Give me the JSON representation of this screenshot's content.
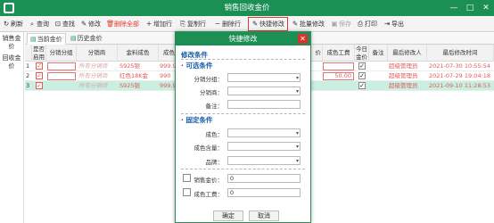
{
  "window": {
    "title": "销售回收金价"
  },
  "toolbar": {
    "refresh": "刷新",
    "query": "查询",
    "find": "查找",
    "edit": "修改",
    "delete_all": "删除全部",
    "add_row": "增加行",
    "copy_row": "复制行",
    "delete_row": "删除行",
    "quick_edit": "快捷修改",
    "batch_edit": "批量修改",
    "save": "保存",
    "print": "打印",
    "export": "导出"
  },
  "left_nav": [
    {
      "label": "销售金价"
    },
    {
      "label": "回收金价"
    }
  ],
  "tabs": [
    {
      "label": "当前金价"
    },
    {
      "label": "历史金价"
    }
  ],
  "grid": {
    "headers": {
      "num": "",
      "enabled": "是否启用",
      "group": "分销分组",
      "dealer": "分销商",
      "gold_color": "金料成色",
      "fineness": "成色",
      "price": "价",
      "labor": "成色工费",
      "today": "今日金价",
      "remark": "备注",
      "modifier": "最后修改人",
      "mod_time": "最后修改时间"
    },
    "rows": [
      {
        "num": "1",
        "dealer": "所有分销商",
        "gold_color": "S925银",
        "fineness": "999.9",
        "labor": "",
        "modifier": "超级管理员",
        "time": "2021-07-30 10:55:54"
      },
      {
        "num": "2",
        "dealer": "所有分销商",
        "gold_color": "红色18K金",
        "fineness": "990",
        "labor": "50.00",
        "modifier": "超级管理员",
        "time": "2021-07-29 19:04:18"
      },
      {
        "num": "3",
        "dealer": "所有分销商",
        "gold_color": "S925银",
        "fineness": "999.9",
        "labor": "",
        "modifier": "超级管理员",
        "time": "2021-09-10 11:28:53"
      }
    ]
  },
  "dialog": {
    "title": "快捷修改",
    "section_conditions": "修改条件",
    "section_optional": "· 可选条件",
    "label_group": "分销分组：",
    "label_dealer": "分销商：",
    "label_remark": "备注：",
    "section_fixed": "· 固定条件",
    "label_color": "成色：",
    "label_content": "成色含量：",
    "label_brand": "品牌：",
    "label_price": "销售金价：",
    "price_value": "0",
    "label_labor": "成色工费：",
    "labor_value": "0",
    "ok": "确定",
    "cancel": "取消"
  }
}
